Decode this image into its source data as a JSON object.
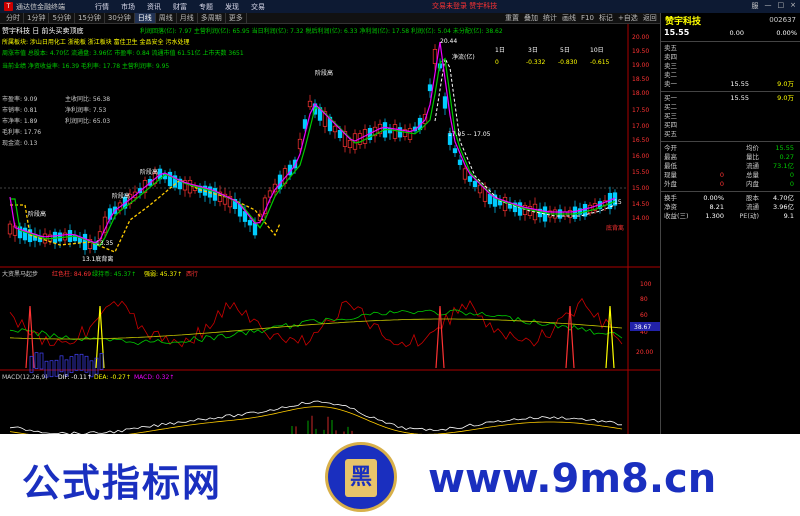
{
  "window": {
    "title": "通达信金融终端",
    "menu": [
      "行情",
      "市场",
      "资讯",
      "财富",
      "专题",
      "发现",
      "交易"
    ],
    "center_tip": "交易未登录  赞宇科技",
    "controls": [
      "服",
      "—",
      "□",
      "×"
    ]
  },
  "toolbar": {
    "periods": [
      "分时",
      "1分钟",
      "5分钟",
      "15分钟",
      "30分钟",
      "日线",
      "周线",
      "月线",
      "多周期",
      "更多"
    ],
    "active": "日线",
    "right": [
      "重置",
      "叠加",
      "统计",
      "画线",
      "F10",
      "标记",
      "+自选",
      "返回"
    ]
  },
  "info": {
    "stock_line": "赞宇科技 日  前头买卖顶底",
    "line2": "所属板块: 涉山日用化工 浙能板 浙江板块 富佳卫生 金品安全 污水处理",
    "line3": "周涨市值 总股本: 4.70亿 流通盘: 3.96亿 市盈率: 0.84 流通市值 61.51亿 上市天数 3651",
    "line4": "当前业绩  净资收益率: 16.39 毛利率: 17.78 主营利润率: 9.95",
    "lines_left": [
      "市盈率: 9.09",
      "市销率: 0.81",
      "市净率: 1.89",
      "毛利率: 17.76",
      "现金流: 0.13"
    ],
    "lines_mid": [
      "主收同比: 56.38",
      "净利润率: 7.53",
      "利润同比: 65.03"
    ],
    "netflow_label": "净流(亿)",
    "netflow_headers": [
      "1日",
      "3日",
      "5日",
      "10日"
    ],
    "netflow_vals": [
      "0",
      "-0.332",
      "-0.830",
      "-0.615"
    ],
    "top_indicators": "利润回落(亿): 7.97  主营利润(亿): 65.95  当日利润(亿): 7.32  税后利润(亿): 6.33  净利润(亿): 17.58  利润(亿): 5.04  未分配(亿): 38.62",
    "annotations": [
      "阶段高",
      "阶段高",
      "阶段高",
      "阶段高",
      "13.1底背离",
      "底背离"
    ],
    "peak": "20.44",
    "ma_label": "17.05 -- 17.05",
    "low_label": "13.35",
    "price_15": "15",
    "price_axis": [
      "20.00",
      "19.50",
      "19.00",
      "18.50",
      "18.00",
      "17.50",
      "17.00",
      "16.50",
      "16.00",
      "15.50",
      "15.00",
      "14.50",
      "14.00"
    ]
  },
  "ind1": {
    "title": "大资黑马起步",
    "items": [
      "红色柱: 84.69",
      "绿持币: 45.37↑",
      "强弱: 45.37↑",
      "西行"
    ],
    "axis": [
      "100",
      "80",
      "60",
      "40",
      "20.00"
    ],
    "cur": "38.67"
  },
  "ind2": {
    "title": "MACD(12,26,9)",
    "items": [
      "DIF: -0.11↑",
      "DEA: -0.27↑",
      "MACD: 0.32↑"
    ]
  },
  "quote": {
    "name": "赞宇科技",
    "code": "002637",
    "price": "15.55",
    "change": "0.00",
    "pct": "0.00%",
    "asks": [
      {
        "l": "卖五",
        "p": "",
        "v": ""
      },
      {
        "l": "卖四",
        "p": "",
        "v": ""
      },
      {
        "l": "卖三",
        "p": "",
        "v": ""
      },
      {
        "l": "卖二",
        "p": "",
        "v": ""
      },
      {
        "l": "卖一",
        "p": "15.55",
        "v": "9.0万"
      }
    ],
    "bids": [
      {
        "l": "买一",
        "p": "15.55",
        "v": "9.0万"
      },
      {
        "l": "买二",
        "p": "",
        "v": ""
      },
      {
        "l": "买三",
        "p": "",
        "v": ""
      },
      {
        "l": "买四",
        "p": "",
        "v": ""
      },
      {
        "l": "买五",
        "p": "",
        "v": ""
      }
    ],
    "stats": [
      {
        "a": "今开",
        "b": "",
        "c": "均价",
        "d": "15.55"
      },
      {
        "a": "最高",
        "b": "",
        "c": "量比",
        "d": "0.27"
      },
      {
        "a": "最低",
        "b": "",
        "c": "流通",
        "d": "73.1亿"
      },
      {
        "a": "现量",
        "b": "0",
        "c": "总量",
        "d": "0"
      },
      {
        "a": "外盘",
        "b": "0",
        "c": "内盘",
        "d": "0"
      }
    ],
    "stats2": [
      {
        "a": "换手",
        "b": "0.00%",
        "c": "股本",
        "d": "4.70亿"
      },
      {
        "a": "净资",
        "b": "8.21",
        "c": "流通",
        "d": "3.96亿"
      },
      {
        "a": "收益(三)",
        "b": "1.300",
        "c": "PE(动)",
        "d": "9.1"
      }
    ]
  },
  "banner": {
    "left": "公式指标网",
    "right": "www.9m8.cn",
    "badge": "黑"
  }
}
